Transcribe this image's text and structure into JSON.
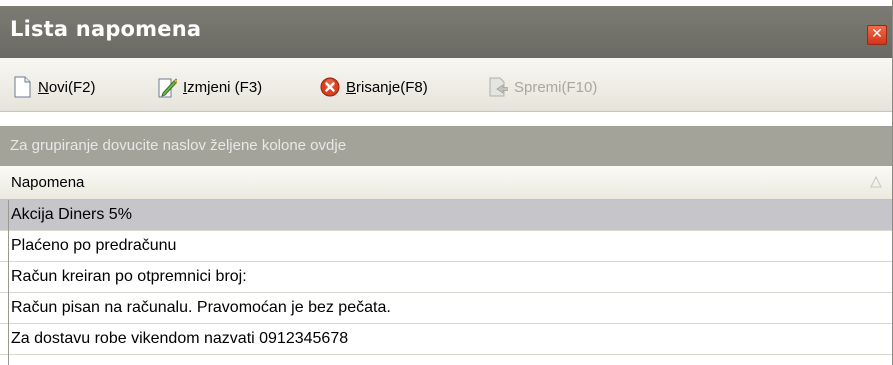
{
  "window": {
    "title": "Lista napomena"
  },
  "toolbar": {
    "buttons": [
      {
        "hotkey_letter": "N",
        "rest": "ovi(F2)",
        "icon": "new-document-icon",
        "enabled": true
      },
      {
        "hotkey_letter": "I",
        "rest": "zmjeni (F3)",
        "icon": "edit-document-icon",
        "enabled": true
      },
      {
        "hotkey_letter": "B",
        "rest": "risanje(F8)",
        "icon": "delete-x-icon",
        "enabled": true
      },
      {
        "hotkey_letter": "",
        "rest": "Spremi(F10)",
        "icon": "save-document-icon",
        "enabled": false
      }
    ]
  },
  "grid": {
    "group_panel_text": "Za grupiranje dovucite naslov željene kolone ovdje",
    "columns": [
      "Napomena"
    ],
    "sort_icon": "sort-indicator-icon",
    "rows": [
      {
        "napomena": "Akcija Diners 5%",
        "selected": true
      },
      {
        "napomena": "Plaćeno po predračunu",
        "selected": false
      },
      {
        "napomena": "Račun kreiran po otpremnici broj:",
        "selected": false
      },
      {
        "napomena": "Račun pisan na računalu. Pravomoćan je bez pečata.",
        "selected": false
      },
      {
        "napomena": "Za dostavu robe vikendom nazvati 0912345678",
        "selected": false
      }
    ]
  },
  "colors": {
    "title_bar": "#6f6f68",
    "group_panel": "#a3a39a",
    "selected_row": "#c6c6ca",
    "close_button": "#e04a2a"
  }
}
